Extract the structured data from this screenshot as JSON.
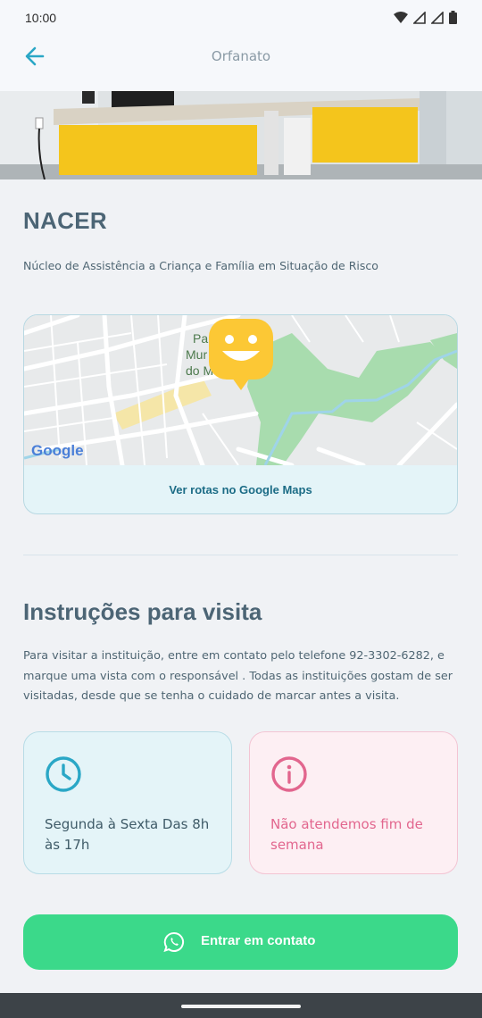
{
  "status_bar": {
    "time": "10:00",
    "icons": [
      "wifi-icon",
      "signal-icon",
      "signal-icon",
      "battery-icon"
    ]
  },
  "app_bar": {
    "title": "Orfanato",
    "back_icon": "arrow-left-icon"
  },
  "institution": {
    "name": "NACER",
    "full_name": "Núcleo de Assistência a Criança e Família em Situação de Risco"
  },
  "map": {
    "labels": [
      "Pa",
      "Mur",
      "do M"
    ],
    "provider_logo": "Google",
    "link_label": "Ver rotas no Google Maps",
    "pin_icon": "smiley-pin-icon"
  },
  "visit": {
    "title": "Instruções para visita",
    "instructions": "Para visitar a instituição, entre em contato pelo telefone 92-3302-6282, e marque uma vista com o responsável . Todas as instituições gostam de ser visitadas, desde que se tenha o cuidado de marcar antes a visita.",
    "hours_icon": "clock-icon",
    "hours_text": "Segunda à Sexta Das 8h às 17h",
    "closed_icon": "info-icon",
    "closed_text": "Não atendemos fim de semana"
  },
  "contact_button": {
    "label": "Entrar em contato",
    "icon": "whatsapp-icon"
  },
  "colors": {
    "accent_blue": "#2aa7c6",
    "title_text": "#4c6575",
    "cta_green": "#3bd98a",
    "closed_pink": "#e2668e",
    "pin_yellow": "#fcc835"
  }
}
